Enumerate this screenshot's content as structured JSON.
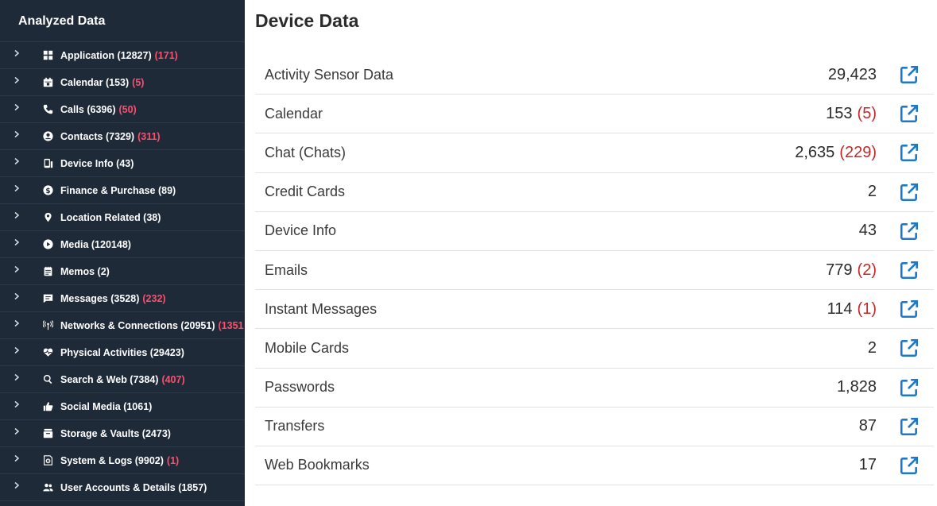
{
  "sidebar": {
    "title": "Analyzed Data",
    "items": [
      {
        "icon": "grid-icon",
        "label": "Application (12827)",
        "red": "(171)"
      },
      {
        "icon": "calendar-icon",
        "label": "Calendar (153)",
        "red": "(5)"
      },
      {
        "icon": "phone-icon",
        "label": "Calls (6396)",
        "red": "(50)"
      },
      {
        "icon": "user-circle-icon",
        "label": "Contacts (7329)",
        "red": "(311)"
      },
      {
        "icon": "device-info-icon",
        "label": "Device Info (43)",
        "red": ""
      },
      {
        "icon": "dollar-icon",
        "label": "Finance & Purchase (89)",
        "red": ""
      },
      {
        "icon": "location-pin-icon",
        "label": "Location Related (38)",
        "red": ""
      },
      {
        "icon": "play-circle-icon",
        "label": "Media (120148)",
        "red": ""
      },
      {
        "icon": "memo-icon",
        "label": "Memos (2)",
        "red": ""
      },
      {
        "icon": "message-icon",
        "label": "Messages (3528)",
        "red": "(232)"
      },
      {
        "icon": "antenna-icon",
        "label": "Networks & Connections (20951)",
        "red": "(1351"
      },
      {
        "icon": "heart-pulse-icon",
        "label": "Physical Activities (29423)",
        "red": ""
      },
      {
        "icon": "search-icon",
        "label": "Search & Web (7384)",
        "red": "(407)"
      },
      {
        "icon": "thumbs-up-icon",
        "label": "Social Media (1061)",
        "red": ""
      },
      {
        "icon": "vault-icon",
        "label": "Storage & Vaults (2473)",
        "red": ""
      },
      {
        "icon": "system-logs-icon",
        "label": "System & Logs (9902)",
        "red": "(1)"
      },
      {
        "icon": "users-icon",
        "label": "User Accounts & Details (1857)",
        "red": ""
      }
    ]
  },
  "main": {
    "title": "Device Data",
    "rows": [
      {
        "label": "Activity Sensor Data",
        "value": "29,423",
        "red": ""
      },
      {
        "label": "Calendar",
        "value": "153",
        "red": "(5)"
      },
      {
        "label": "Chat (Chats)",
        "value": "2,635",
        "red": "(229)"
      },
      {
        "label": "Credit Cards",
        "value": "2",
        "red": ""
      },
      {
        "label": "Device Info",
        "value": "43",
        "red": ""
      },
      {
        "label": "Emails",
        "value": "779",
        "red": "(2)"
      },
      {
        "label": "Instant Messages",
        "value": "114",
        "red": "(1)"
      },
      {
        "label": "Mobile Cards",
        "value": "2",
        "red": ""
      },
      {
        "label": "Passwords",
        "value": "1,828",
        "red": ""
      },
      {
        "label": "Transfers",
        "value": "87",
        "red": ""
      },
      {
        "label": "Web Bookmarks",
        "value": "17",
        "red": ""
      }
    ]
  },
  "colors": {
    "sidebar_bg": "#1f2a38",
    "badge_red": "#ff4d6d",
    "count_red": "#c62828",
    "open_icon_blue": "#1e78c8"
  }
}
